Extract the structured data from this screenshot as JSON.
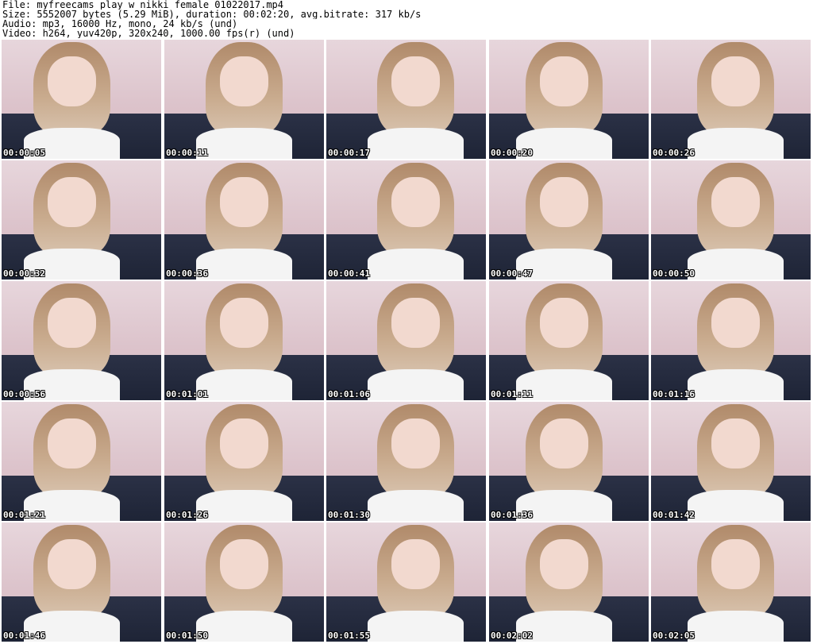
{
  "header": {
    "file": "File: myfreecams_play_w_nikki_female_01022017.mp4",
    "size": "Size: 5552007 bytes (5.29 MiB), duration: 00:02:20, avg.bitrate: 317 kb/s",
    "audio": "Audio: mp3, 16000 Hz, mono, 24 kb/s (und)",
    "video": "Video: h264, yuv420p, 320x240, 1000.00 fps(r) (und)"
  },
  "thumbnails": [
    {
      "time": "00:00:05"
    },
    {
      "time": "00:00:11"
    },
    {
      "time": "00:00:17"
    },
    {
      "time": "00:00:20"
    },
    {
      "time": "00:00:26"
    },
    {
      "time": "00:00:32"
    },
    {
      "time": "00:00:36"
    },
    {
      "time": "00:00:41"
    },
    {
      "time": "00:00:47"
    },
    {
      "time": "00:00:50"
    },
    {
      "time": "00:00:56"
    },
    {
      "time": "00:01:01"
    },
    {
      "time": "00:01:06"
    },
    {
      "time": "00:01:11"
    },
    {
      "time": "00:01:16"
    },
    {
      "time": "00:01:21"
    },
    {
      "time": "00:01:26"
    },
    {
      "time": "00:01:30"
    },
    {
      "time": "00:01:36"
    },
    {
      "time": "00:01:42"
    },
    {
      "time": "00:01:46"
    },
    {
      "time": "00:01:50"
    },
    {
      "time": "00:01:55"
    },
    {
      "time": "00:02:02"
    },
    {
      "time": "00:02:05"
    }
  ]
}
